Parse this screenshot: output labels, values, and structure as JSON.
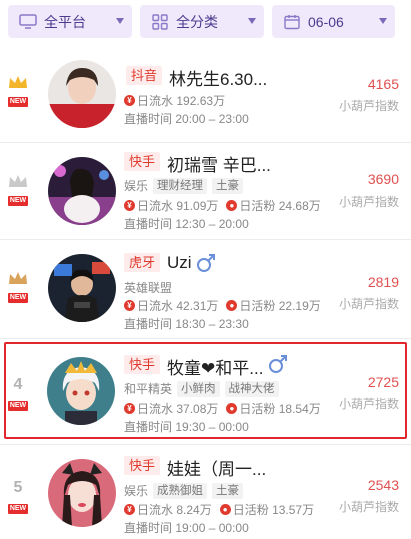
{
  "filters": {
    "platform": {
      "label": "全平台",
      "icon": "monitor-icon"
    },
    "category": {
      "label": "全分类",
      "icon": "grid-icon"
    },
    "date": {
      "label": "06-06",
      "icon": "calendar-icon"
    }
  },
  "score_label": "小葫芦指数",
  "labels": {
    "flow": "日流水",
    "fans": "日活粉",
    "time": "直播时间",
    "new": "NEW"
  },
  "streamers": [
    {
      "rank": "1",
      "crown": "gold",
      "is_new": true,
      "platform": "抖音",
      "name": "林先生6.30...",
      "male": false,
      "tags": [],
      "flow": "192.63万",
      "fans": "",
      "time": "20:00 – 23:00",
      "score": "4165"
    },
    {
      "rank": "2",
      "crown": "silver",
      "is_new": true,
      "platform": "快手",
      "name": "初瑞雪 辛巴...",
      "male": false,
      "category": "娱乐",
      "tags": [
        "理财经理",
        "土豪"
      ],
      "flow": "91.09万",
      "fans": "24.68万",
      "time": "12:30 – 20:00",
      "score": "3690"
    },
    {
      "rank": "3",
      "crown": "bronze",
      "is_new": true,
      "platform": "虎牙",
      "name": "Uzi",
      "male": true,
      "category": "英雄联盟",
      "tags": [],
      "flow": "42.31万",
      "fans": "22.19万",
      "time": "18:30 – 23:30",
      "score": "2819"
    },
    {
      "rank": "4",
      "crown": "",
      "is_new": true,
      "platform": "快手",
      "name": "牧童❤和平...",
      "male": true,
      "category": "和平精英",
      "tags": [
        "小鲜肉",
        "战神大佬"
      ],
      "flow": "37.08万",
      "fans": "18.54万",
      "time": "19:30 – 00:00",
      "score": "2725"
    },
    {
      "rank": "5",
      "crown": "",
      "is_new": true,
      "platform": "快手",
      "name": "娃娃（周一...",
      "male": false,
      "category": "娱乐",
      "tags": [
        "成熟御姐",
        "土豪"
      ],
      "flow": "8.24万",
      "fans": "13.57万",
      "time": "19:00 – 00:00",
      "score": "2543"
    }
  ],
  "colors": {
    "accent": "#e03a2e",
    "filter_bg": "#f0e9fb",
    "highlight": "#e2262b",
    "male": "#6a8fd8"
  }
}
